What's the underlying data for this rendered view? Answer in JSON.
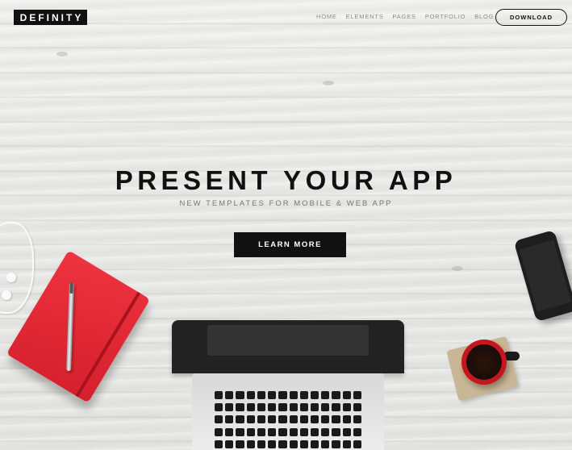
{
  "brand": {
    "logo_text": "DEFINITY"
  },
  "nav": {
    "items": [
      {
        "label": "HOME"
      },
      {
        "label": "ELEMENTS"
      },
      {
        "label": "PAGES"
      },
      {
        "label": "PORTFOLIO"
      },
      {
        "label": "BLOG"
      }
    ],
    "download_label": "DOWNLOAD"
  },
  "hero": {
    "title": "PRESENT YOUR APP",
    "subtitle": "NEW TEMPLATES FOR MOBILE & WEB APP",
    "cta_label": "LEARN MORE"
  },
  "colors": {
    "primary": "#111111",
    "background": "#e9e9e7",
    "notebook": "#e0212f",
    "mug": "#c8161e"
  }
}
